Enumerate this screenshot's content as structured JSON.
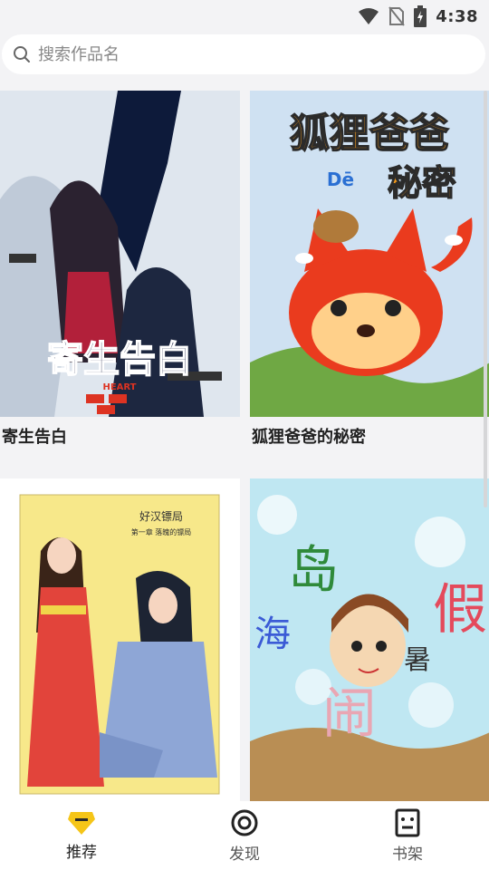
{
  "status_bar": {
    "time": "4:38"
  },
  "search": {
    "placeholder": "搜索作品名",
    "value": ""
  },
  "comics": [
    {
      "title": "寄生告白",
      "cover_text": "寄生告白",
      "cover_subtext": "HEART"
    },
    {
      "title": "狐狸爸爸的秘密",
      "cover_text": "狐狸爸爸",
      "cover_subtext": "Dē",
      "cover_text2": "秘密"
    },
    {
      "title": "",
      "cover_text": "好汉镖局",
      "cover_subtext": "第一章 落魄的镖局"
    },
    {
      "title": "",
      "cover_text": "岛",
      "cover_text_b": "海",
      "cover_text_c": "假",
      "cover_text_d": "闹",
      "cover_text_e": "暑"
    }
  ],
  "tabs": [
    {
      "label": "推荐",
      "icon": "diamond-icon",
      "active": true
    },
    {
      "label": "发现",
      "icon": "target-icon",
      "active": false
    },
    {
      "label": "书架",
      "icon": "bookshelf-icon",
      "active": false
    }
  ],
  "colors": {
    "accent": "#f5c518",
    "text": "#222222",
    "muted": "#888888"
  }
}
